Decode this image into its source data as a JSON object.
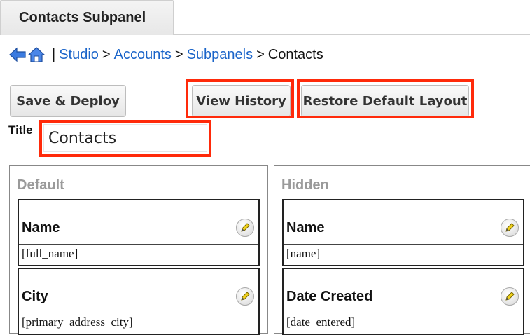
{
  "tab": {
    "label": "Contacts Subpanel"
  },
  "breadcrumb": {
    "separator": "|",
    "items": [
      "Studio",
      "Accounts",
      "Subpanels",
      "Contacts"
    ],
    "arrow": ">"
  },
  "toolbar": {
    "save_deploy": "Save & Deploy",
    "view_history": "View History",
    "restore_default": "Restore Default Layout"
  },
  "title_field": {
    "label": "Title",
    "value": "Contacts"
  },
  "panels": {
    "default": {
      "title": "Default",
      "fields": [
        {
          "label": "Name",
          "key": "[full_name]"
        },
        {
          "label": "City",
          "key": "[primary_address_city]"
        }
      ]
    },
    "hidden": {
      "title": "Hidden",
      "fields": [
        {
          "label": "Name",
          "key": "[name]"
        },
        {
          "label": "Date Created",
          "key": "[date_entered]"
        }
      ]
    }
  },
  "colors": {
    "link": "#1a64c9",
    "highlight": "#ff2a0a",
    "panel_title": "#9a9a9a"
  },
  "icons": [
    "back-arrow-icon",
    "home-icon",
    "pencil-edit-icon"
  ]
}
